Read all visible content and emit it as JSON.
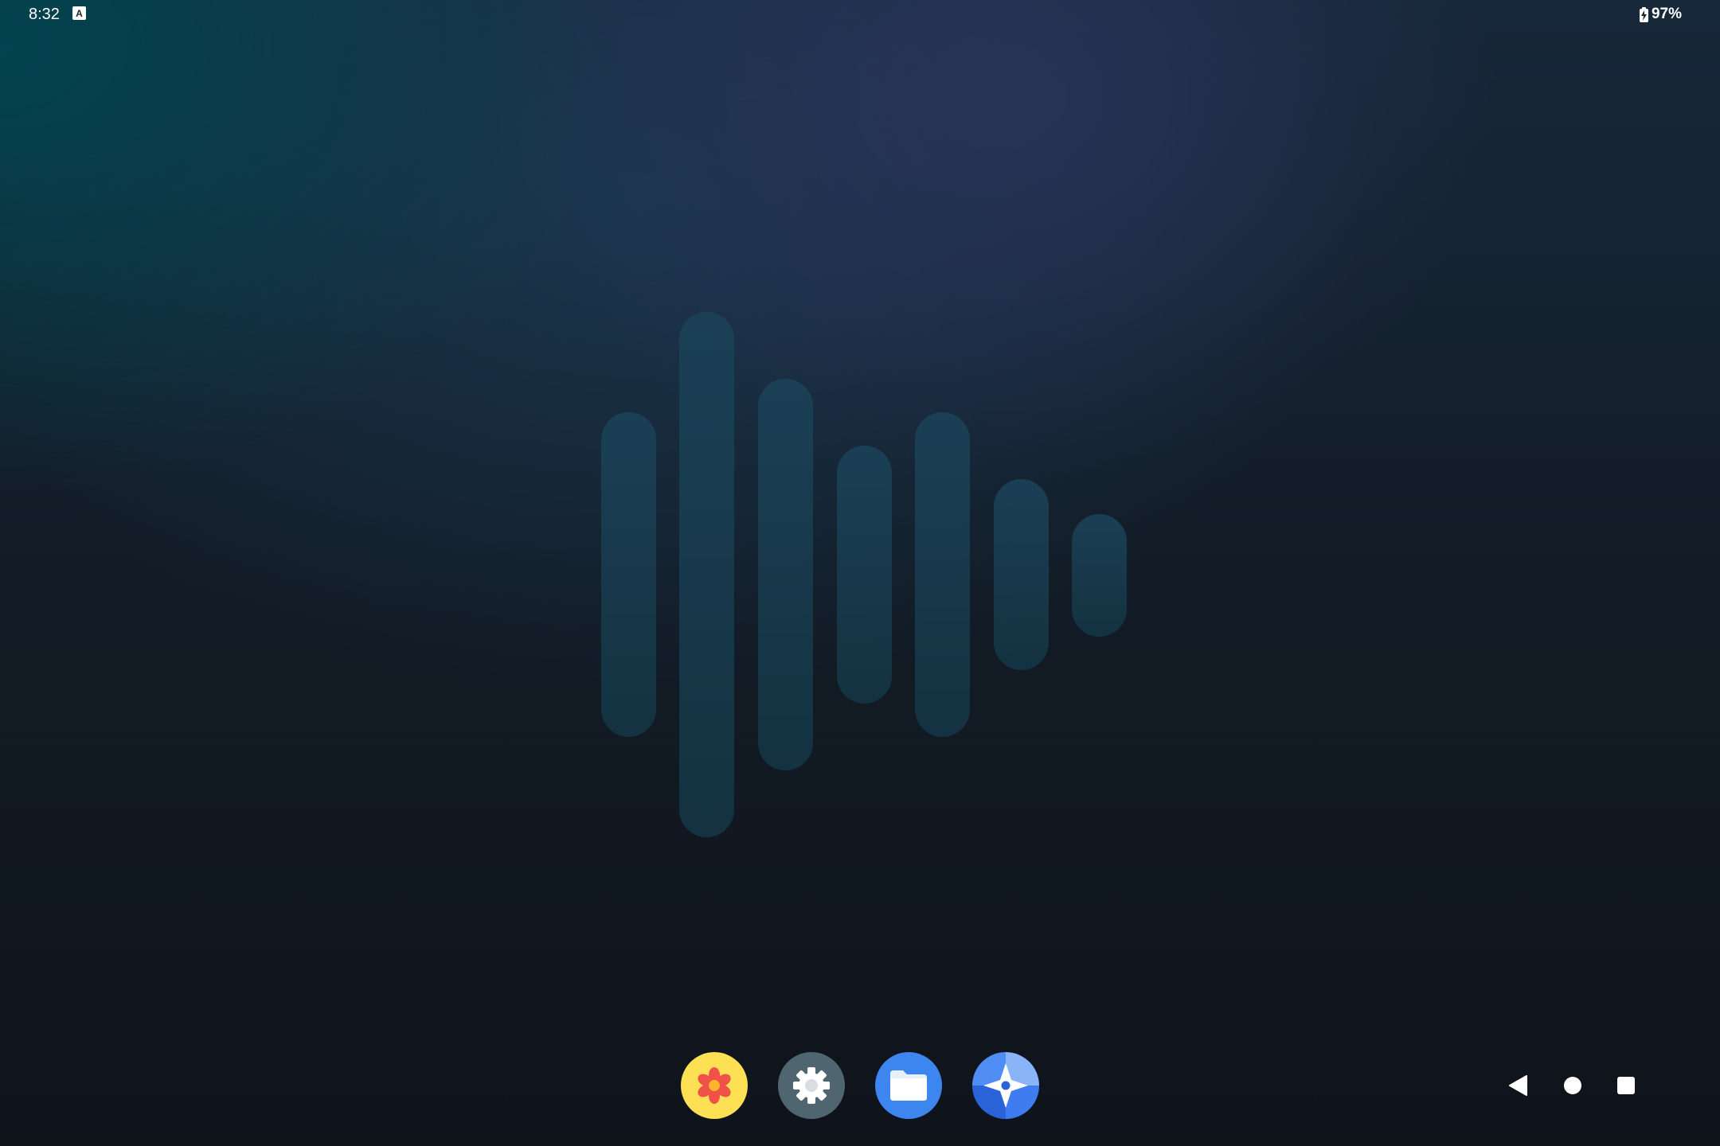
{
  "status_bar": {
    "time": "8:32",
    "notification_icon_letter": "A",
    "battery_percent": "97%"
  },
  "wallpaper": {
    "logo": "waveform-logo",
    "bar_color": "#1e4a60"
  },
  "dock": {
    "apps": [
      {
        "name": "gallery",
        "icon": "flower-icon",
        "color": "#fde053"
      },
      {
        "name": "settings",
        "icon": "gear-icon",
        "color": "#4f6670"
      },
      {
        "name": "files",
        "icon": "folder-icon",
        "color": "#3d86f0"
      },
      {
        "name": "compass",
        "icon": "compass-icon",
        "color": "#2f6fe6"
      }
    ]
  },
  "nav_bar": {
    "buttons": [
      "back-icon",
      "home-icon",
      "recents-icon"
    ]
  }
}
